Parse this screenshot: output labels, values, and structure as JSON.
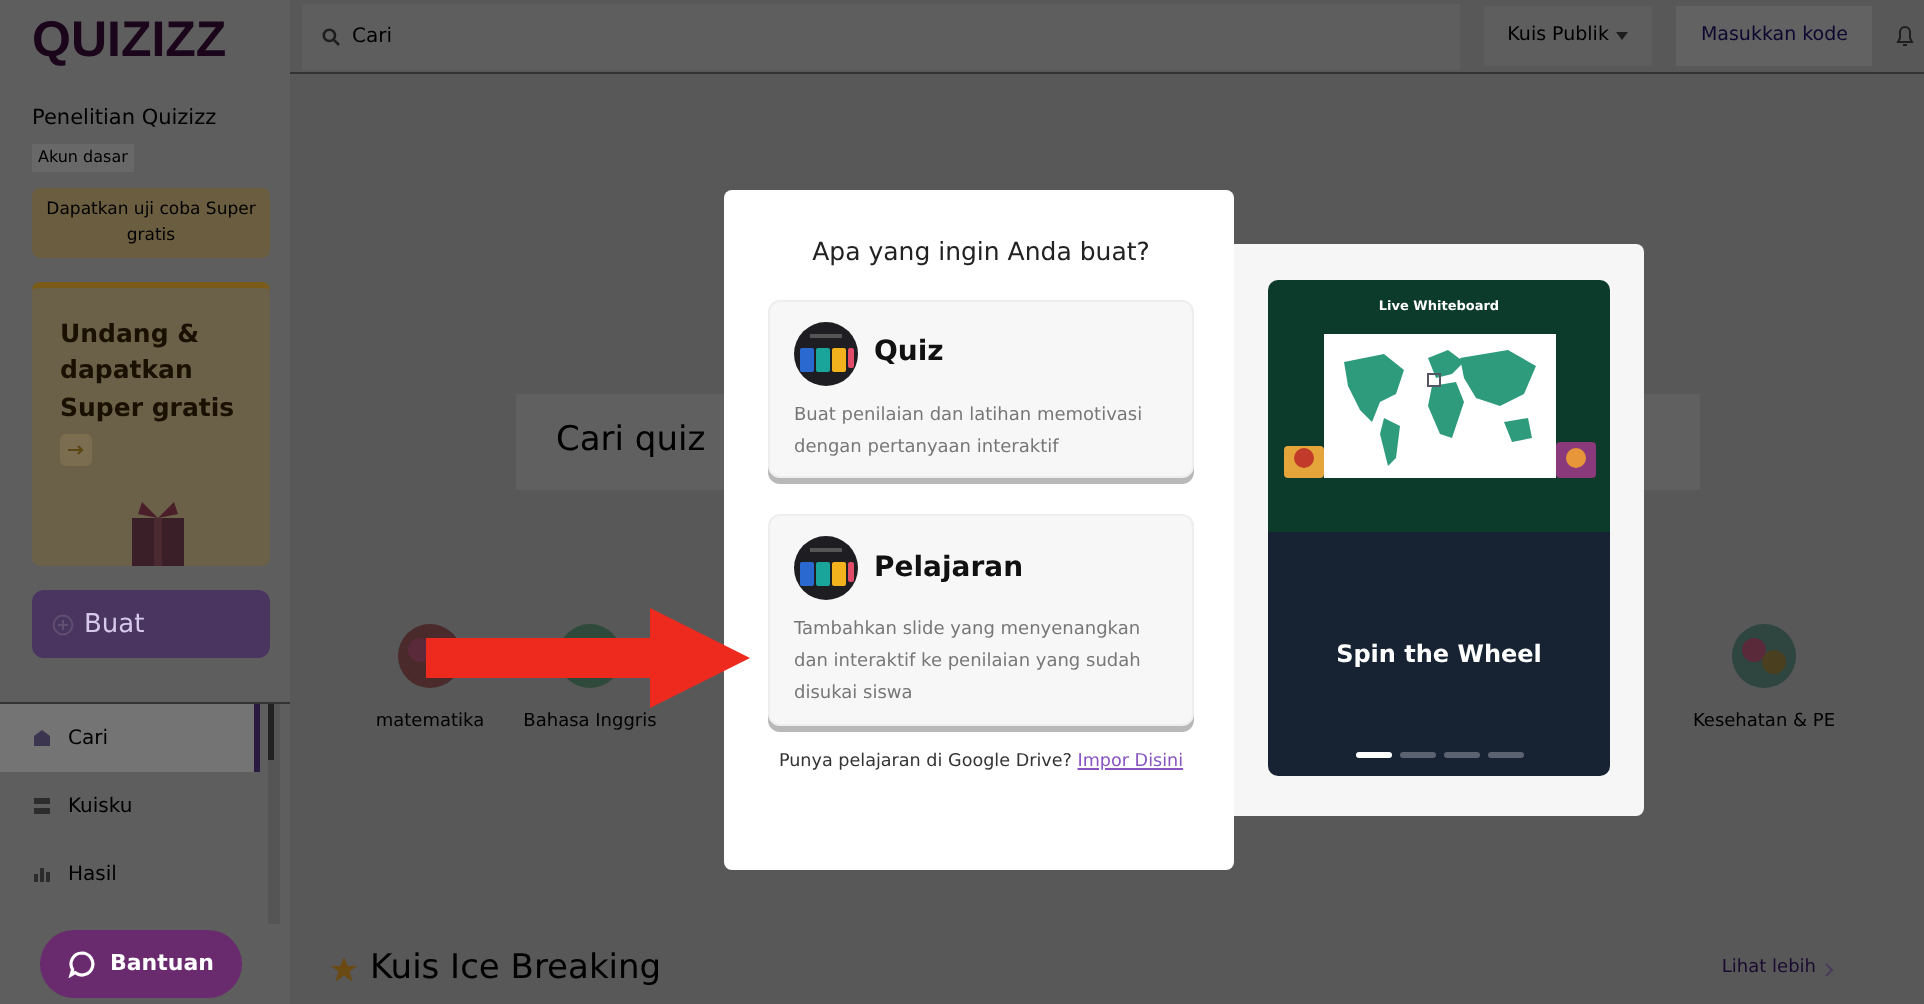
{
  "topbar": {
    "logo": "QUIZIZZ",
    "search": {
      "placeholder": "Cari"
    },
    "dropdown": "Kuis Publik",
    "code_button": "Masukkan kode"
  },
  "sidebar": {
    "account_name": "Penelitian Quizizz",
    "account_type": "Akun dasar",
    "trial_button": "Dapatkan uji coba Super gratis",
    "invite_card": "Undang & dapatkan Super gratis",
    "create_button": "Buat",
    "nav": [
      {
        "label": "Cari",
        "selected": true
      },
      {
        "label": "Kuisku",
        "selected": false
      },
      {
        "label": "Hasil",
        "selected": false
      }
    ]
  },
  "main": {
    "search": {
      "placeholder": "Cari quiz"
    },
    "categories": [
      {
        "label": "matematika"
      },
      {
        "label": "Bahasa Inggris"
      },
      {
        "label": "Kesehatan & PE"
      }
    ],
    "section": {
      "title": "Kuis Ice Breaking",
      "more": "Lihat lebih"
    }
  },
  "help_button": "Bantuan",
  "dialog": {
    "title": "Apa yang ingin Anda buat?",
    "options": [
      {
        "title": "Quiz",
        "description": "Buat penilaian dan latihan memotivasi dengan pertanyaan interaktif"
      },
      {
        "title": "Pelajaran",
        "description": "Tambahkan slide yang menyenangkan dan interaktif ke penilaian yang sudah disukai siswa"
      }
    ],
    "footer": {
      "text": "Punya pelajaran di Google Drive?",
      "link": "Impor Disini"
    }
  },
  "preview": {
    "slide_title": "Live Whiteboard",
    "caption": "Spin the Wheel",
    "indicators": [
      {
        "selected": true
      },
      {
        "selected": false
      },
      {
        "selected": false
      },
      {
        "selected": false
      }
    ]
  }
}
